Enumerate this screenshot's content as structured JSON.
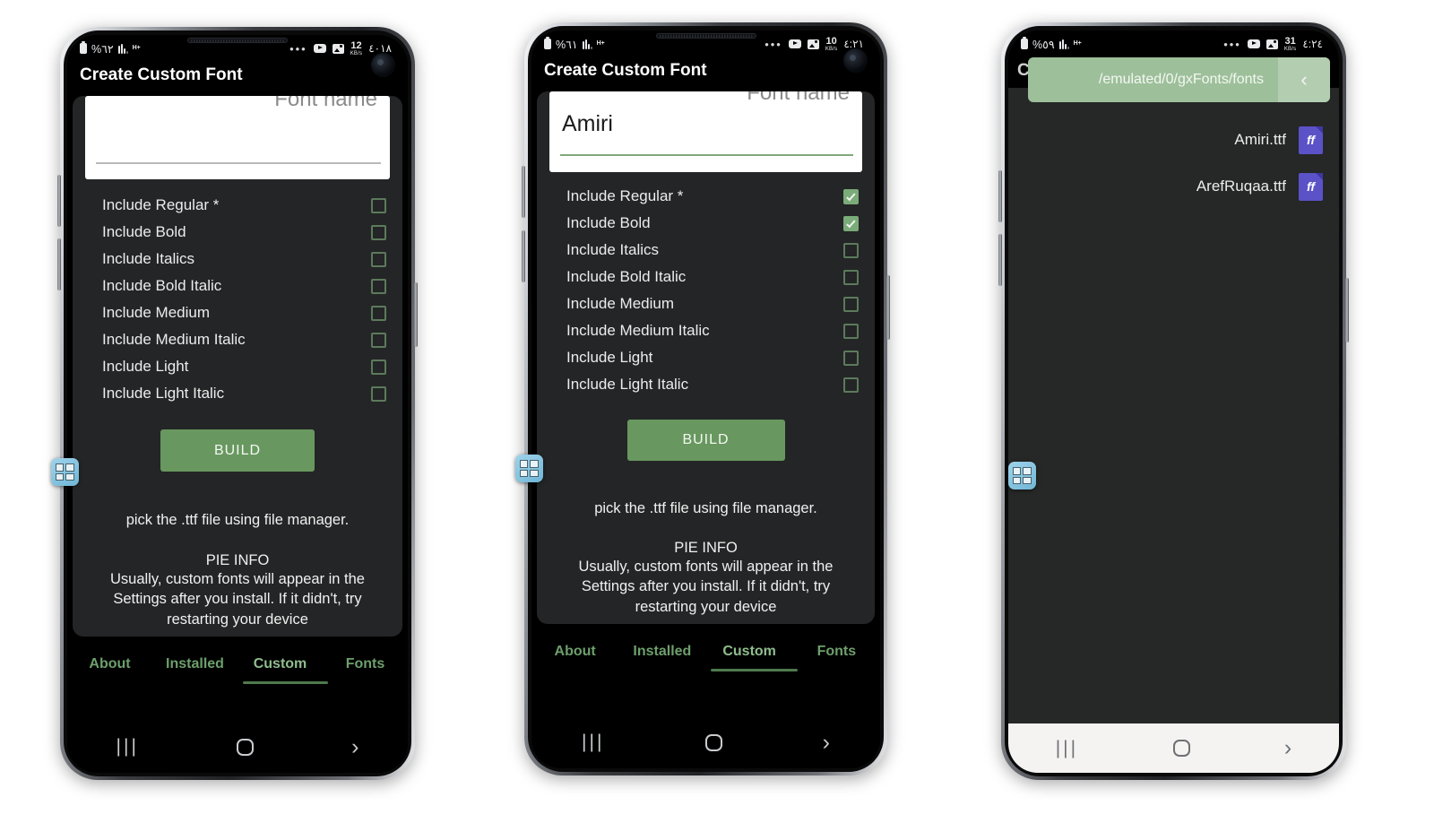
{
  "phones": [
    {
      "id": "phone-left",
      "status": {
        "battery_pct": "%٦٢",
        "network_type": "H+",
        "dots": "•••",
        "speed_value": "12",
        "speed_unit": "KB/s",
        "clock": "٤٠١٨"
      },
      "app": {
        "title": "Create Custom Font",
        "field": {
          "label": "Font name",
          "value": "",
          "placeholder": "Font name",
          "underline_color": "#b9b9b9"
        },
        "options": [
          {
            "label": "Include Regular *",
            "checked": false
          },
          {
            "label": "Include Bold",
            "checked": false
          },
          {
            "label": "Include Italics",
            "checked": false
          },
          {
            "label": "Include Bold Italic",
            "checked": false
          },
          {
            "label": "Include Medium",
            "checked": false
          },
          {
            "label": "Include Medium Italic",
            "checked": false
          },
          {
            "label": "Include Light",
            "checked": false
          },
          {
            "label": "Include Light Italic",
            "checked": false
          }
        ],
        "build_label": "BUILD",
        "hint": "pick the .ttf file using file manager.",
        "pie_title": "PIE INFO",
        "pie_body": "Usually, custom fonts will appear in the Settings after you install. If it didn't, try restarting your device",
        "tabs": [
          {
            "label": "About",
            "active": false
          },
          {
            "label": "Installed",
            "active": false
          },
          {
            "label": "Custom",
            "active": true
          },
          {
            "label": "Fonts",
            "active": false
          }
        ]
      },
      "navbar": {
        "recent": "|||",
        "home": "",
        "back": "›",
        "theme": "dark"
      }
    },
    {
      "id": "phone-center",
      "status": {
        "battery_pct": "%٦١",
        "network_type": "H+",
        "dots": "•••",
        "speed_value": "10",
        "speed_unit": "KB/s",
        "clock": "٤:٢١"
      },
      "app": {
        "title": "Create Custom Font",
        "field": {
          "label": "Font name",
          "value": "Amiri",
          "placeholder": "Font name",
          "underline_color": "#7fa87c"
        },
        "options": [
          {
            "label": "Include Regular *",
            "checked": true
          },
          {
            "label": "Include Bold",
            "checked": true
          },
          {
            "label": "Include Italics",
            "checked": false
          },
          {
            "label": "Include Bold Italic",
            "checked": false
          },
          {
            "label": "Include Medium",
            "checked": false
          },
          {
            "label": "Include Medium Italic",
            "checked": false
          },
          {
            "label": "Include Light",
            "checked": false
          },
          {
            "label": "Include Light Italic",
            "checked": false
          }
        ],
        "build_label": "BUILD",
        "hint": "pick the .ttf file using file manager.",
        "pie_title": "PIE INFO",
        "pie_body": "Usually, custom fonts will appear in the Settings after you install. If it didn't, try restarting your device",
        "tabs": [
          {
            "label": "About",
            "active": false
          },
          {
            "label": "Installed",
            "active": false
          },
          {
            "label": "Custom",
            "active": true
          },
          {
            "label": "Fonts",
            "active": false
          }
        ]
      },
      "navbar": {
        "recent": "|||",
        "home": "",
        "back": "›",
        "theme": "dark"
      }
    },
    {
      "id": "phone-right",
      "status": {
        "battery_pct": "%٥٩",
        "network_type": "H+",
        "dots": "•••",
        "speed_value": "31",
        "speed_unit": "KB/s",
        "clock": "٤:٢٤"
      },
      "filemanager": {
        "partial_title": "C",
        "path": "/emulated/0/gxFonts/fonts",
        "back_icon": "‹",
        "files": [
          {
            "name": "Amiri.ttf",
            "icon": "font-file-icon",
            "icon_text": "ff"
          },
          {
            "name": "ArefRuqaa.ttf",
            "icon": "font-file-icon",
            "icon_text": "ff"
          }
        ]
      },
      "navbar": {
        "recent": "|||",
        "home": "",
        "back": "›",
        "theme": "light"
      }
    }
  ],
  "overlay": {
    "icon_name": "floating-overlay-icon"
  },
  "colors": {
    "accent_green": "#68985f",
    "tab_green": "#6d9f6c",
    "pathbar_green": "#9dc09a",
    "checkbox_green": "#7aab79",
    "file_icon_purple": "#5b52c8",
    "app_bg": "#000000",
    "card_bg": "#242526"
  }
}
